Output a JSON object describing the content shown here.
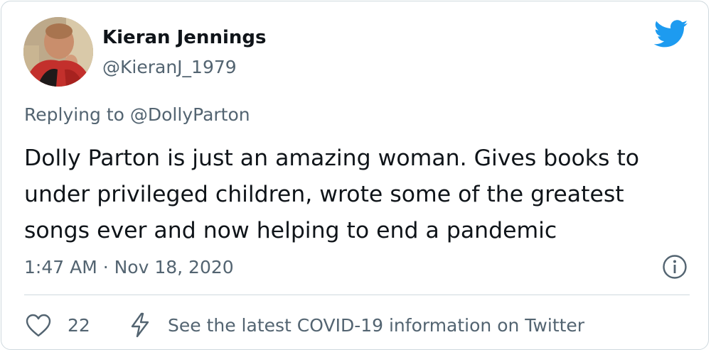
{
  "tweet": {
    "author": {
      "display_name": "Kieran Jennings",
      "handle": "@KieranJ_1979"
    },
    "replying_to": "Replying to @DollyParton",
    "text": "Dolly Parton is just an amazing woman. Gives books to under privileged children, wrote some of the greatest songs ever and now helping to end a pandemic",
    "timestamp": "1:47 AM · Nov 18, 2020",
    "likes": "22",
    "covid_info": "See the latest COVID-19 information on Twitter"
  },
  "icons": {
    "brand": "twitter-bird-icon",
    "info": "info-icon",
    "like": "heart-icon",
    "covid": "lightning-bolt-icon"
  },
  "colors": {
    "brand": "#1d9bf0",
    "secondary_text": "#536471",
    "primary_text": "#0f1419",
    "border": "#cfd9de"
  }
}
